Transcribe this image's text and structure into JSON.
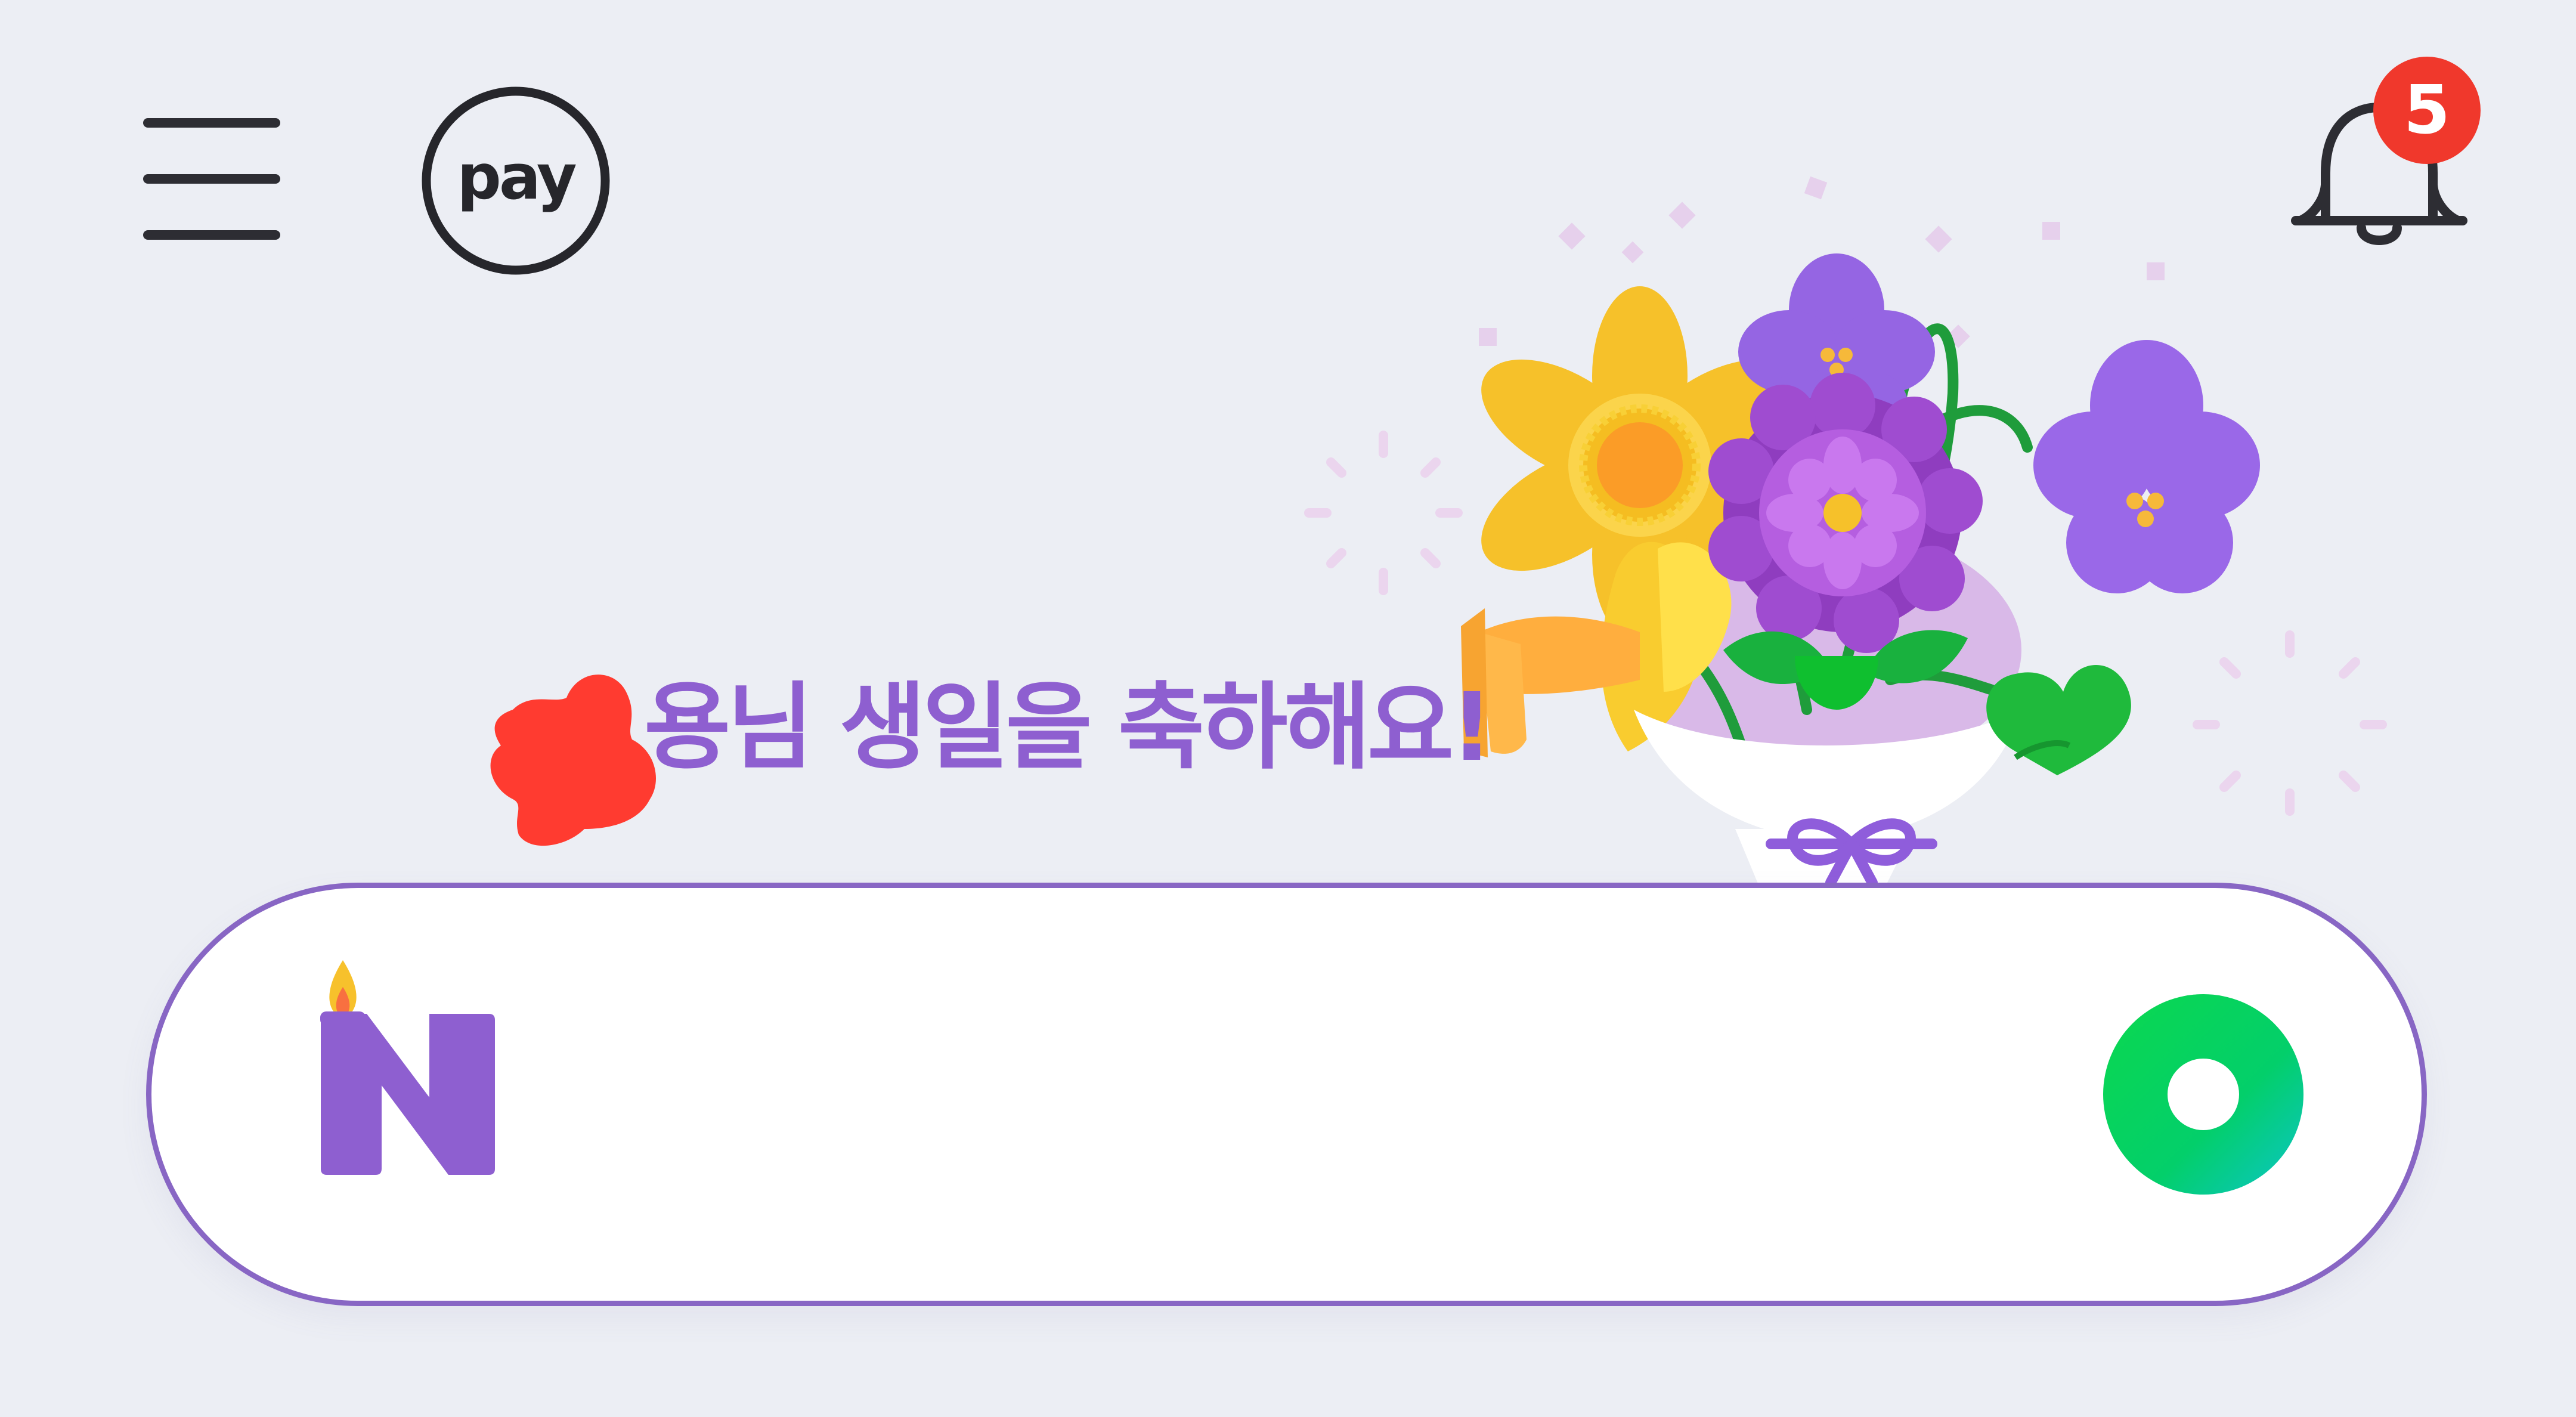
{
  "header": {
    "menu_icon": "hamburger-menu-icon",
    "logo_text": "pay",
    "notification_icon": "bell-icon",
    "notification_count": "5"
  },
  "banner": {
    "greeting_name": "",
    "greeting_text": "용님 생일을 축하해요!",
    "illustration": "flower-bouquet",
    "name_redacted": true
  },
  "search": {
    "logo_icon": "naver-n-birthday-candle-icon",
    "input_value": "",
    "input_placeholder": "",
    "action_icon": "green-ring-icon"
  },
  "colors": {
    "background": "#eceef4",
    "accent_purple": "#8e5fd0",
    "search_border": "#8866c4",
    "badge_red": "#f0382c",
    "green": "#03c75a"
  }
}
